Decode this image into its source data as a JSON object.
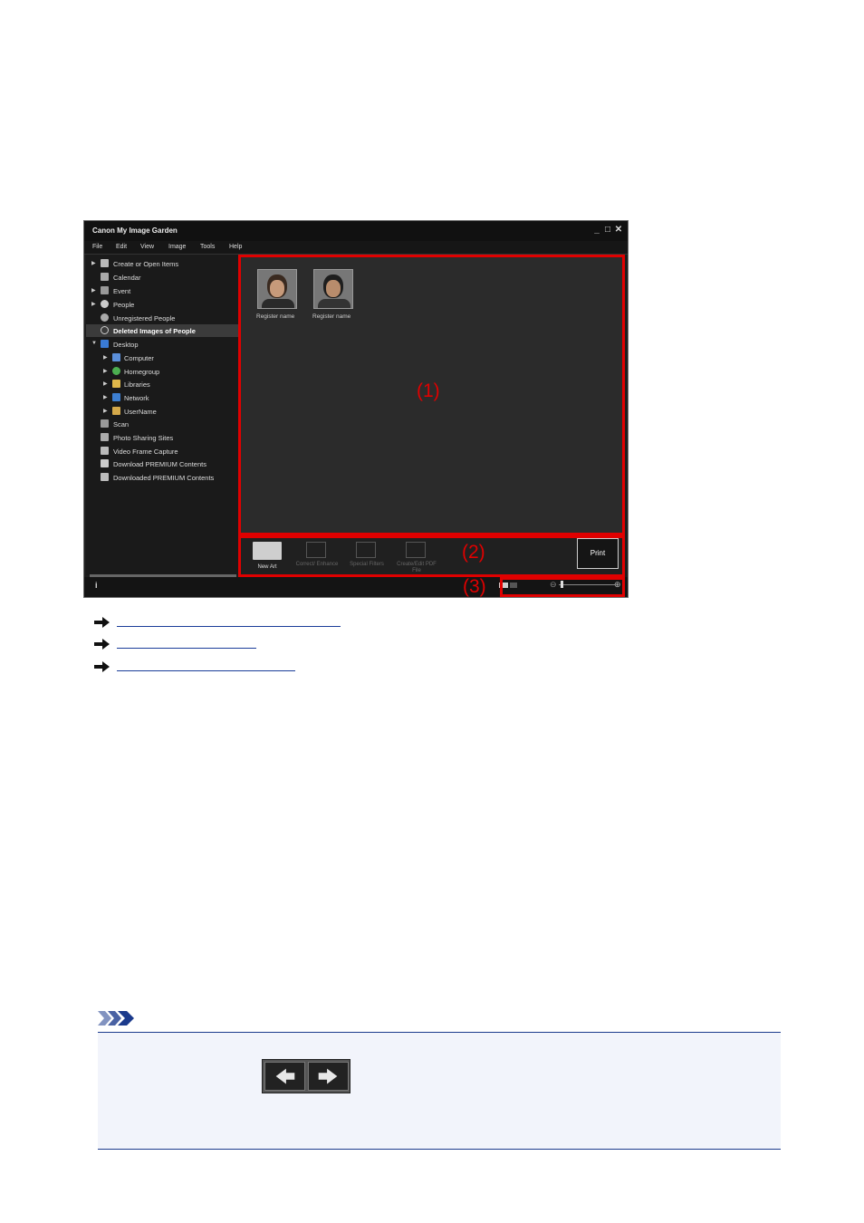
{
  "window": {
    "title": "Canon My Image Garden",
    "controls": [
      "_",
      "□",
      "✕"
    ],
    "menu": [
      "File",
      "Edit",
      "View",
      "Image",
      "Tools",
      "Help"
    ]
  },
  "sidebar": {
    "items": [
      {
        "label": "Create or Open Items",
        "icon": "create-open-icon"
      },
      {
        "label": "Calendar",
        "icon": "calendar-icon"
      },
      {
        "label": "Event",
        "icon": "event-icon"
      },
      {
        "label": "People",
        "icon": "people-icon"
      },
      {
        "label": "Unregistered People",
        "icon": "unregistered-people-icon"
      },
      {
        "label": "Deleted Images of People",
        "icon": "deleted-people-icon",
        "selected": true
      },
      {
        "label": "Desktop",
        "icon": "desktop-icon"
      },
      {
        "label": "Computer",
        "icon": "computer-icon"
      },
      {
        "label": "Homegroup",
        "icon": "homegroup-icon"
      },
      {
        "label": "Libraries",
        "icon": "libraries-icon"
      },
      {
        "label": "Network",
        "icon": "network-icon"
      },
      {
        "label": "UserName",
        "icon": "user-folder-icon"
      },
      {
        "label": "Scan",
        "icon": "scan-icon"
      },
      {
        "label": "Photo Sharing Sites",
        "icon": "photo-sharing-icon"
      },
      {
        "label": "Video Frame Capture",
        "icon": "video-frame-icon"
      },
      {
        "label": "Download PREMIUM Contents",
        "icon": "download-premium-icon"
      },
      {
        "label": "Downloaded PREMIUM Contents",
        "icon": "downloaded-premium-icon"
      }
    ]
  },
  "status": {
    "info_label": "i"
  },
  "content": {
    "thumbnails": [
      {
        "label": "Register name"
      },
      {
        "label": "Register name"
      }
    ]
  },
  "toolbar": {
    "new_art": "New Art",
    "correct_enhance": "Correct/ Enhance",
    "special_filters": "Special Filters",
    "create_edit_pdf": "Create/Edit PDF File",
    "print": "Print"
  },
  "callouts": {
    "one": "(1)",
    "two": "(2)",
    "three": "(3)"
  },
  "colors": {
    "callout_red": "#e00000",
    "link_blue": "#1a3c99",
    "note_line": "#1b3a8c",
    "note_bg": "#f2f4fb"
  }
}
